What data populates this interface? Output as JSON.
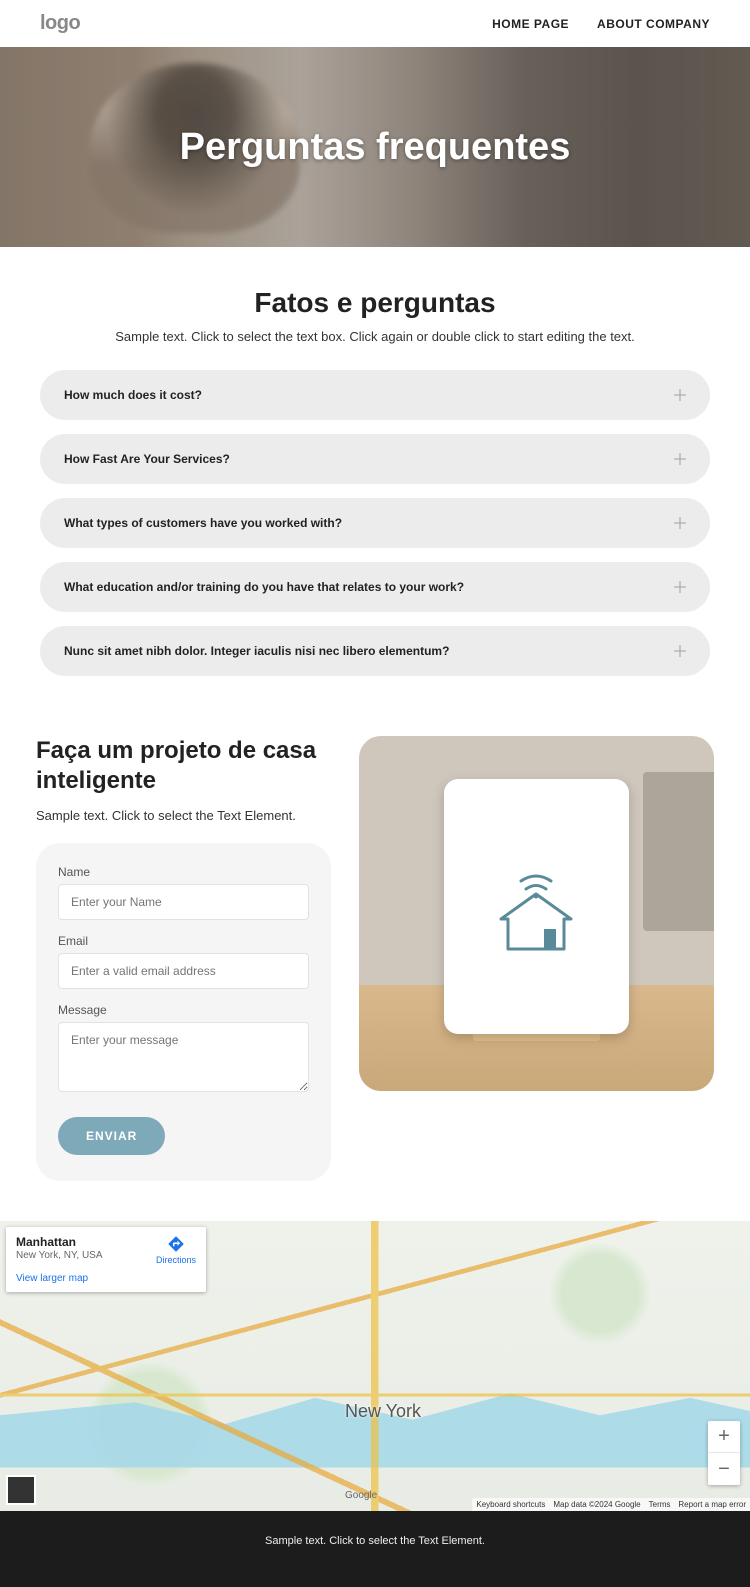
{
  "header": {
    "logo": "logo",
    "nav": {
      "home": "HOME PAGE",
      "about": "ABOUT COMPANY"
    }
  },
  "hero": {
    "title": "Perguntas frequentes"
  },
  "faq": {
    "title": "Fatos e perguntas",
    "desc": "Sample text. Click to select the text box. Click again or double click to start editing the text.",
    "items": [
      "How much does it cost?",
      "How Fast Are Your Services?",
      "What types of customers have you worked with?",
      "What education and/or training do you have that relates to your work?",
      "Nunc sit amet nibh dolor. Integer iaculis nisi nec libero elementum?"
    ]
  },
  "project": {
    "title": "Faça um projeto de casa inteligente",
    "desc": "Sample text. Click to select the Text Element.",
    "form": {
      "name_label": "Name",
      "name_placeholder": "Enter your Name",
      "email_label": "Email",
      "email_placeholder": "Enter a valid email address",
      "message_label": "Message",
      "message_placeholder": "Enter your message",
      "submit": "ENVIAR"
    }
  },
  "map": {
    "card_title": "Manhattan",
    "card_sub": "New York, NY, USA",
    "directions": "Directions",
    "view_larger": "View larger map",
    "city_label": "New York",
    "google": "Google",
    "attrib": {
      "shortcuts": "Keyboard shortcuts",
      "data": "Map data ©2024 Google",
      "terms": "Terms",
      "report": "Report a map error"
    }
  },
  "footer": {
    "text": "Sample text. Click to select the Text Element."
  }
}
